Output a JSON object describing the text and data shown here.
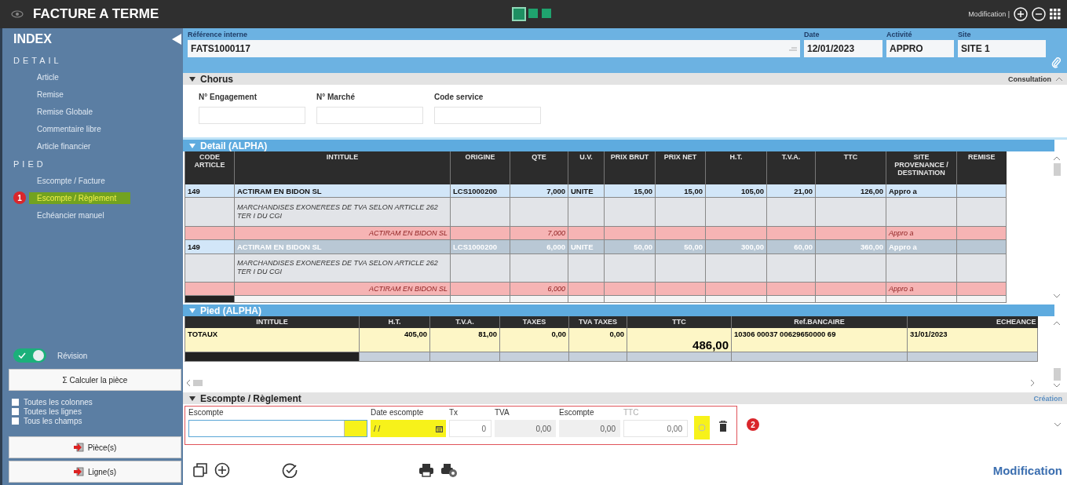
{
  "window": {
    "title": "FACTURE A TERME",
    "mode": "Modification |"
  },
  "view_squares": [
    {
      "selected": true
    },
    {
      "selected": false
    },
    {
      "selected": false
    }
  ],
  "sidebar": {
    "title": "INDEX",
    "sections": [
      {
        "heading": "DETAIL",
        "items": [
          {
            "label": "Article",
            "selected": false
          },
          {
            "label": "Remise",
            "selected": false
          },
          {
            "label": "Remise Globale",
            "selected": false
          },
          {
            "label": "Commentaire libre",
            "selected": false
          },
          {
            "label": "Article financier",
            "selected": false
          }
        ]
      },
      {
        "heading": "PIED",
        "items": [
          {
            "label": "Escompte / Facture",
            "selected": false
          },
          {
            "label": "Escompte / Règlement",
            "selected": true,
            "badge": "1"
          },
          {
            "label": "Echéancier manuel",
            "selected": false
          }
        ]
      }
    ],
    "revision": {
      "label": "Révision",
      "on": true
    },
    "calc_button": "Σ Calculer la pièce",
    "checkboxes": [
      {
        "label": "Toutes les colonnes",
        "checked": false
      },
      {
        "label": "Toutes les lignes",
        "checked": false
      },
      {
        "label": "Tous les champs",
        "checked": false
      }
    ],
    "buttons": [
      "Pièce(s)",
      "Ligne(s)"
    ]
  },
  "header_fields": [
    {
      "label": "Référence interne",
      "value": "FATS1000117"
    },
    {
      "label": "Date",
      "value": "12/01/2023"
    },
    {
      "label": "Activité",
      "value": "APPRO"
    },
    {
      "label": "Site",
      "value": "SITE 1"
    }
  ],
  "chorus": {
    "title": "Chorus",
    "mode": "Consultation",
    "fields": [
      {
        "label": "N° Engagement"
      },
      {
        "label": "N° Marché"
      },
      {
        "label": "Code service"
      }
    ]
  },
  "detail": {
    "title": "Detail (ALPHA)",
    "columns": [
      "CODE ARTICLE",
      "INTITULE",
      "ORIGINE",
      "QTE",
      "U.V.",
      "PRIX BRUT",
      "PRIX NET",
      "H.T.",
      "T.V.A.",
      "TTC",
      "SITE PROVENANCE / DESTINATION",
      "REMISE"
    ],
    "rows": [
      {
        "kind": "article",
        "selected": true,
        "cells": [
          "149",
          "ACTIRAM EN BIDON SL",
          "LCS1000200",
          "7,000",
          "UNITE",
          "15,00",
          "15,00",
          "105,00",
          "21,00",
          "126,00",
          "Appro a"
        ]
      },
      {
        "kind": "note",
        "text": "MARCHANDISES EXONEREES DE TVA SELON ARTICLE 262 TER I DU CGI"
      },
      {
        "kind": "sub",
        "intitule": "ACTIRAM EN BIDON SL",
        "qte": "7,000",
        "site": "Appro a"
      },
      {
        "kind": "article",
        "selected": false,
        "cells": [
          "149",
          "ACTIRAM EN BIDON SL",
          "LCS1000200",
          "6,000",
          "UNITE",
          "50,00",
          "50,00",
          "300,00",
          "60,00",
          "360,00",
          "Appro a"
        ]
      },
      {
        "kind": "note",
        "text": "MARCHANDISES EXONEREES DE TVA SELON ARTICLE 262 TER I DU CGI"
      },
      {
        "kind": "sub",
        "intitule": "ACTIRAM EN BIDON SL",
        "qte": "6,000",
        "site": "Appro a"
      }
    ]
  },
  "pied": {
    "title": "Pied (ALPHA)",
    "columns": [
      "INTITULE",
      "H.T.",
      "T.V.A.",
      "TAXES",
      "TVA TAXES",
      "TTC",
      "Ref.BANCAIRE",
      "ECHEANCE"
    ],
    "rows": [
      {
        "cells": [
          "TOTAUX",
          "405,00",
          "81,00",
          "0,00",
          "0,00",
          "486,00",
          "10306 00037 00629650000 69",
          "31/01/2023"
        ]
      }
    ]
  },
  "escompte": {
    "title": "Escompte / Règlement",
    "mode": "Création",
    "badge": "2",
    "fields": [
      {
        "kind": "text",
        "label": "Escompte"
      },
      {
        "kind": "date",
        "label": "Date escompte",
        "value": "/ /"
      },
      {
        "kind": "number",
        "label": "Tx",
        "value": "0"
      },
      {
        "kind": "readonly",
        "label": "TVA",
        "value": "0,00"
      },
      {
        "kind": "readonly",
        "label": "Escompte",
        "value": "0,00"
      },
      {
        "kind": "muted",
        "label": "TTC",
        "value": "0,00"
      }
    ]
  },
  "status": "Modification"
}
